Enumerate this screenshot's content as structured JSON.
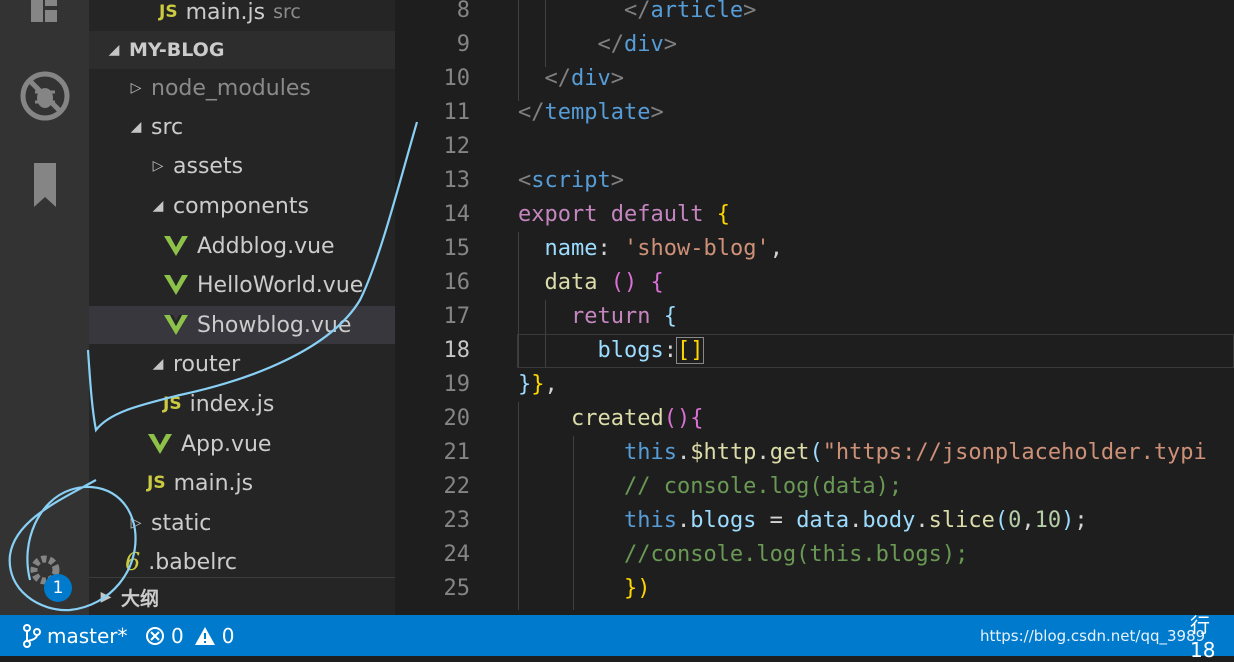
{
  "explorer": {
    "top_file": {
      "name": "main.js",
      "desc": "src"
    },
    "project_header": "MY-BLOG",
    "tree": [
      {
        "label": "node_modules",
        "type": "folder",
        "state": "collapsed",
        "depth": 1
      },
      {
        "label": "src",
        "type": "folder",
        "state": "expanded",
        "depth": 1
      },
      {
        "label": "assets",
        "type": "folder",
        "state": "collapsed",
        "depth": 2
      },
      {
        "label": "components",
        "type": "folder",
        "state": "expanded",
        "depth": 2
      },
      {
        "label": "Addblog.vue",
        "type": "vue",
        "depth": 3
      },
      {
        "label": "HelloWorld.vue",
        "type": "vue",
        "depth": 3
      },
      {
        "label": "Showblog.vue",
        "type": "vue",
        "depth": 3,
        "selected": true
      },
      {
        "label": "router",
        "type": "folder",
        "state": "expanded",
        "depth": 2
      },
      {
        "label": "index.js",
        "type": "js",
        "depth": 3
      },
      {
        "label": "App.vue",
        "type": "vue",
        "depth": 2
      },
      {
        "label": "main.js",
        "type": "js",
        "depth": 2
      },
      {
        "label": "static",
        "type": "folder",
        "state": "collapsed",
        "depth": 1
      },
      {
        "label": ".babelrc",
        "type": "babel",
        "depth": 1
      }
    ],
    "outline_header": "大纲"
  },
  "activity_bar": {
    "icons": [
      "extensions-icon",
      "no-debug-icon",
      "bookmark-icon"
    ],
    "settings_badge": "1"
  },
  "editor": {
    "active_line": "18",
    "lines": [
      {
        "n": "8",
        "tokens": [
          [
            "t-punc",
            "        </"
          ],
          [
            "t-tag",
            "article"
          ],
          [
            "t-punc",
            ">"
          ]
        ]
      },
      {
        "n": "9",
        "tokens": [
          [
            "t-punc",
            "      </"
          ],
          [
            "t-tag",
            "div"
          ],
          [
            "t-punc",
            ">"
          ]
        ]
      },
      {
        "n": "10",
        "tokens": [
          [
            "t-punc",
            "  </"
          ],
          [
            "t-tag",
            "div"
          ],
          [
            "t-punc",
            ">"
          ]
        ]
      },
      {
        "n": "11",
        "tokens": [
          [
            "t-punc",
            "</"
          ],
          [
            "t-tag",
            "template"
          ],
          [
            "t-punc",
            ">"
          ]
        ]
      },
      {
        "n": "12",
        "tokens": []
      },
      {
        "n": "13",
        "tokens": [
          [
            "t-punc",
            "<"
          ],
          [
            "t-tag",
            "script"
          ],
          [
            "t-punc",
            ">"
          ]
        ]
      },
      {
        "n": "14",
        "tokens": [
          [
            "t-kw",
            "export"
          ],
          [
            "t-white",
            " "
          ],
          [
            "t-kw",
            "default"
          ],
          [
            "t-white",
            " "
          ],
          [
            "t-br",
            "{"
          ]
        ]
      },
      {
        "n": "15",
        "tokens": [
          [
            "t-white",
            "  "
          ],
          [
            "t-prop",
            "name"
          ],
          [
            "t-white",
            ": "
          ],
          [
            "t-str",
            "'show-blog'"
          ],
          [
            "t-white",
            ","
          ]
        ]
      },
      {
        "n": "16",
        "tokens": [
          [
            "t-white",
            "  "
          ],
          [
            "t-fn",
            "data"
          ],
          [
            "t-white",
            " "
          ],
          [
            "t-br2",
            "()"
          ],
          [
            "t-white",
            " "
          ],
          [
            "t-br2",
            "{"
          ]
        ]
      },
      {
        "n": "17",
        "tokens": [
          [
            "t-white",
            "    "
          ],
          [
            "t-kw",
            "return"
          ],
          [
            "t-white",
            " "
          ],
          [
            "t-prop",
            "{"
          ]
        ]
      },
      {
        "n": "18",
        "tokens": [
          [
            "t-white",
            "      "
          ],
          [
            "t-prop",
            "blogs"
          ],
          [
            "t-white",
            ":"
          ],
          [
            "t-br",
            "[]"
          ]
        ]
      },
      {
        "n": "19",
        "tokens": [
          [
            "t-prop",
            "}"
          ],
          [
            "t-br",
            "}"
          ],
          [
            "t-white",
            ","
          ]
        ]
      },
      {
        "n": "20",
        "tokens": [
          [
            "t-white",
            "    "
          ],
          [
            "t-fn",
            "created"
          ],
          [
            "t-br2",
            "(){"
          ]
        ]
      },
      {
        "n": "21",
        "tokens": [
          [
            "t-white",
            "        "
          ],
          [
            "t-kw2",
            "this"
          ],
          [
            "t-white",
            "."
          ],
          [
            "t-fn",
            "$http"
          ],
          [
            "t-white",
            "."
          ],
          [
            "t-fn",
            "get"
          ],
          [
            "t-prop",
            "("
          ],
          [
            "t-str",
            "\"https://jsonplaceholder.typi"
          ]
        ]
      },
      {
        "n": "22",
        "tokens": [
          [
            "t-white",
            "        "
          ],
          [
            "t-cmt",
            "// console.log(data);"
          ]
        ]
      },
      {
        "n": "23",
        "tokens": [
          [
            "t-white",
            "        "
          ],
          [
            "t-kw2",
            "this"
          ],
          [
            "t-white",
            "."
          ],
          [
            "t-prop",
            "blogs"
          ],
          [
            "t-white",
            " = "
          ],
          [
            "t-prop",
            "data"
          ],
          [
            "t-white",
            "."
          ],
          [
            "t-prop",
            "body"
          ],
          [
            "t-white",
            "."
          ],
          [
            "t-fn",
            "slice"
          ],
          [
            "t-prop",
            "("
          ],
          [
            "t-num",
            "0"
          ],
          [
            "t-white",
            ","
          ],
          [
            "t-num",
            "10"
          ],
          [
            "t-prop",
            ")"
          ],
          [
            "t-white",
            ";"
          ]
        ]
      },
      {
        "n": "24",
        "tokens": [
          [
            "t-white",
            "        "
          ],
          [
            "t-cmt",
            "//console.log(this.blogs);"
          ]
        ]
      },
      {
        "n": "25",
        "tokens": [
          [
            "t-white",
            "        "
          ],
          [
            "t-br",
            "})"
          ]
        ]
      }
    ]
  },
  "status": {
    "branch": "master*",
    "errors": "0",
    "warnings": "0",
    "watermark": "https://blog.csdn.net/qq_3989",
    "line_label": "行 18"
  },
  "colors": {
    "accent": "#007acc",
    "vue_green": "#8dc149",
    "js_yellow": "#cbcb41",
    "annotation": "#89d0f5"
  }
}
